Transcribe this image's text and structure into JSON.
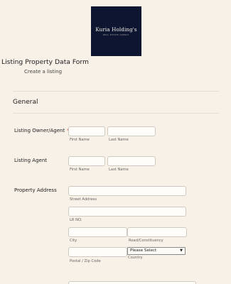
{
  "logo": {
    "brand": "Kuria Holding's",
    "tagline": "REAL ESTATE AGENCY"
  },
  "form": {
    "title": "Listing Property Data Form",
    "subtitle": "Create a listing"
  },
  "section": {
    "title": "General"
  },
  "fields": {
    "owner": {
      "label": "Listing Owner/Agent",
      "required_mark": "*",
      "first": {
        "value": "",
        "sublabel": "First Name"
      },
      "last": {
        "value": "",
        "sublabel": "Last Name"
      }
    },
    "agent": {
      "label": "Listing Agent",
      "first": {
        "value": "",
        "sublabel": "First Name"
      },
      "last": {
        "value": "",
        "sublabel": "Last Name"
      }
    },
    "address": {
      "label": "Property Address",
      "street": {
        "value": "",
        "sublabel": "Street Address"
      },
      "lr_no": {
        "value": "",
        "sublabel": "LR NO."
      },
      "city": {
        "value": "",
        "sublabel": "City"
      },
      "road": {
        "value": "",
        "sublabel": "Road/Constituency"
      },
      "postal": {
        "value": "",
        "sublabel": "Postal / Zip Code"
      },
      "country": {
        "selected": "Please Select",
        "sublabel": "Country"
      }
    }
  }
}
